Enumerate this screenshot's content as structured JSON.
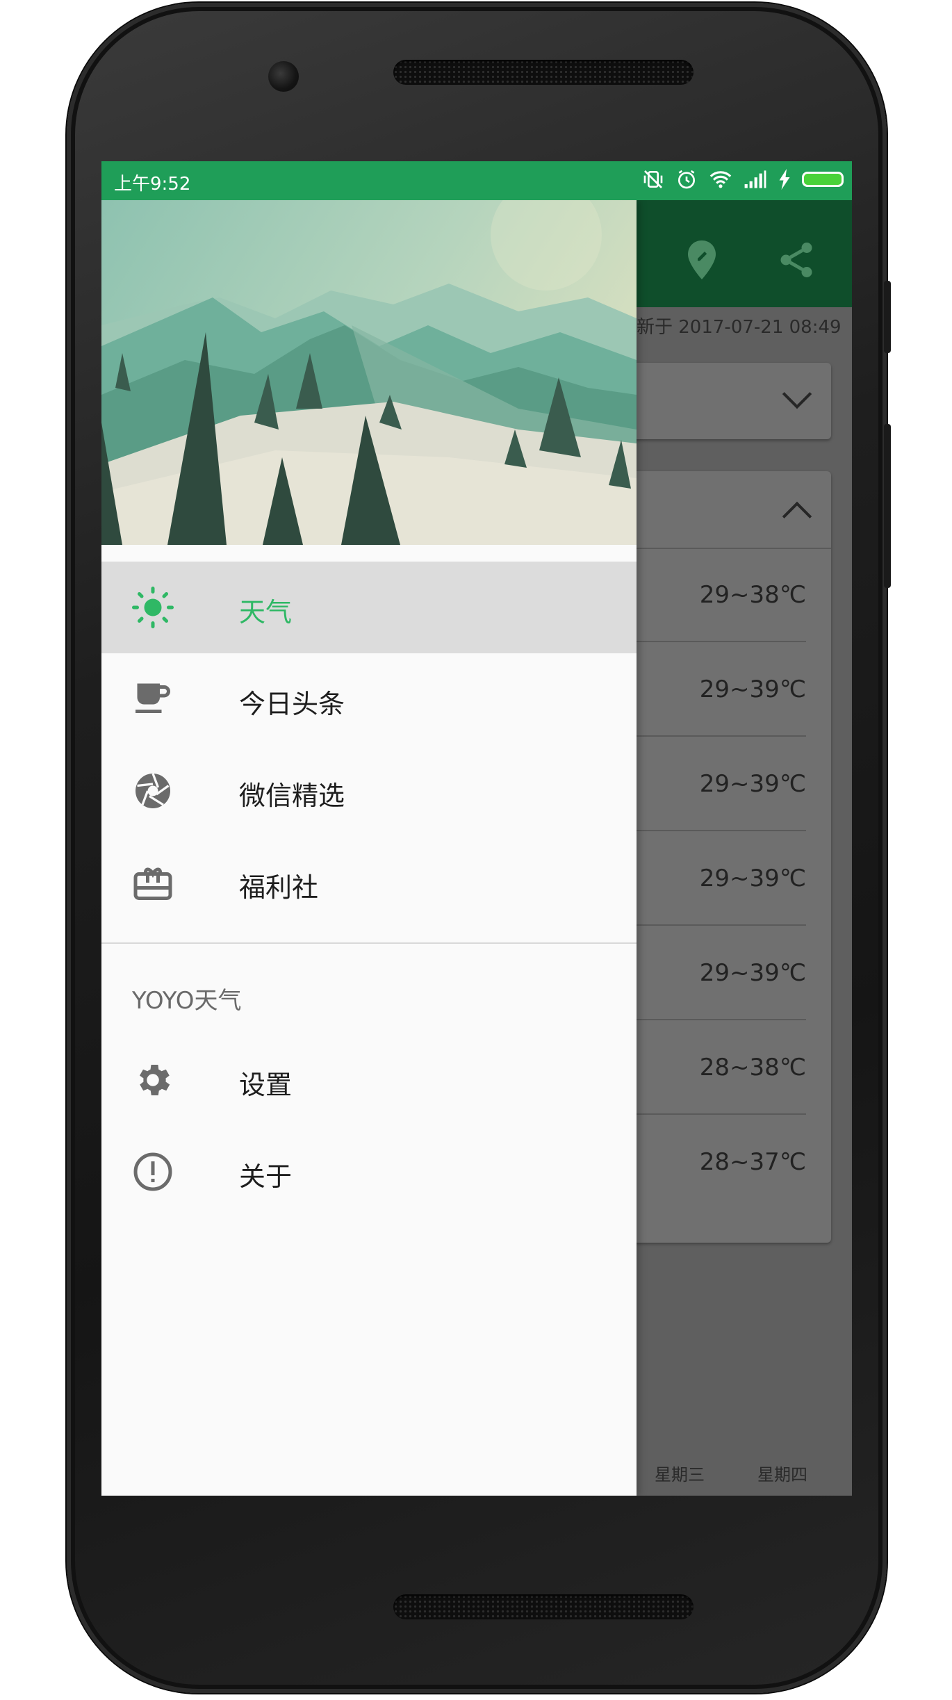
{
  "status_bar": {
    "time": "上午9:52",
    "icons": [
      "vibrate-off-icon",
      "alarm-icon",
      "wifi-icon",
      "signal-icon",
      "charging-icon",
      "battery-icon"
    ],
    "color": "#1f9e58"
  },
  "app": {
    "toolbar_color": "#0f4e2b",
    "update_text": "新于 2017-07-21 08:49",
    "forecast_temps": [
      "29~38℃",
      "29~39℃",
      "29~39℃",
      "29~39℃",
      "29~39℃",
      "28~38℃",
      "28~37℃"
    ],
    "weekdays": [
      "星期三",
      "星期四"
    ]
  },
  "drawer": {
    "header_image": "mountain-landscape-illustration",
    "items": [
      {
        "label": "天气",
        "icon": "sun-icon",
        "selected": true
      },
      {
        "label": "今日头条",
        "icon": "coffee-cup-icon",
        "selected": false
      },
      {
        "label": "微信精选",
        "icon": "camera-shutter-icon",
        "selected": false
      },
      {
        "label": "福利社",
        "icon": "gift-card-icon",
        "selected": false
      }
    ],
    "section_title": "YOYO天气",
    "sub_items": [
      {
        "label": "设置",
        "icon": "gear-icon"
      },
      {
        "label": "关于",
        "icon": "info-alert-icon"
      }
    ],
    "accent_color": "#2fb865"
  }
}
